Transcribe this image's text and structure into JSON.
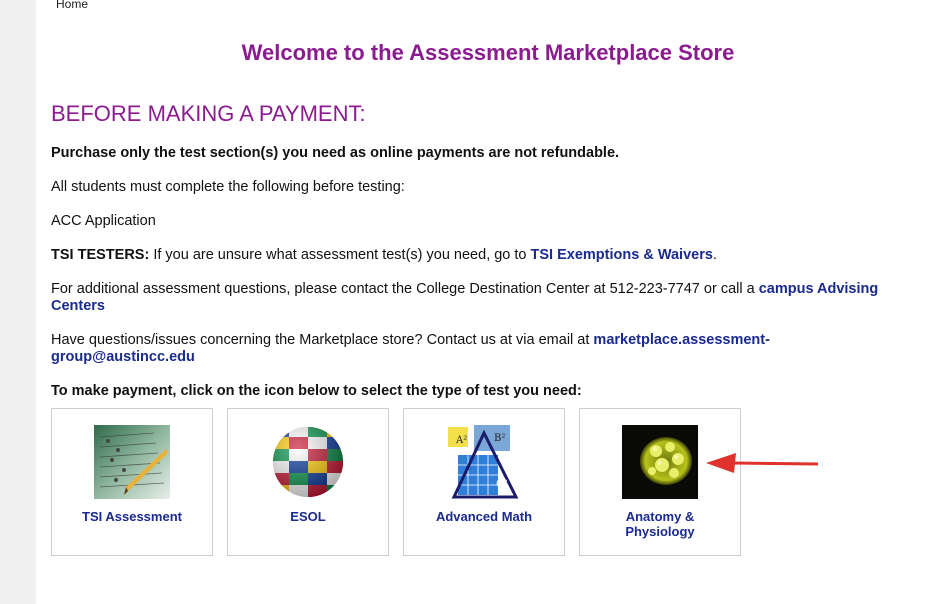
{
  "breadcrumb": "Home",
  "title": "Welcome to the Assessment Marketplace Store",
  "heading": "BEFORE MAKING A PAYMENT:",
  "notice_bold": "Purchase only the test section(s) you need as online payments are not refundable.",
  "students_line": "All students must complete the following before testing:",
  "application_line": "ACC Application",
  "tsi": {
    "label": "TSI TESTERS:",
    "text": " If you are unsure what assessment test(s) you need, go to ",
    "link": "TSI Exemptions & Waivers",
    "end": "."
  },
  "additional": {
    "text": "For additional assessment questions, please contact the College Destination Center at 512-223-7747 or call a ",
    "link_line1": "campus Advising",
    "link_line2": "Centers"
  },
  "questions": {
    "text": "Have questions/issues concerning the Marketplace store? Contact us at via email at ",
    "link_line1": "marketplace.assessment-",
    "link_line2": "group@austincc.edu"
  },
  "instruction": "To make payment, click on the icon below to select the type of test you need:",
  "cards": [
    {
      "label": "TSI Assessment",
      "icon": "test-sheet-pencil-icon"
    },
    {
      "label": "ESOL",
      "icon": "world-flags-globe-icon"
    },
    {
      "label": "Advanced Math",
      "icon": "pythagorean-triangle-icon"
    },
    {
      "label_line1": "Anatomy &",
      "label_line2": "Physiology",
      "icon": "cell-microscope-icon"
    }
  ],
  "colors": {
    "heading_purple": "#8b1c8f",
    "link_blue": "#1a2a8f",
    "arrow_red": "#e0322d"
  }
}
